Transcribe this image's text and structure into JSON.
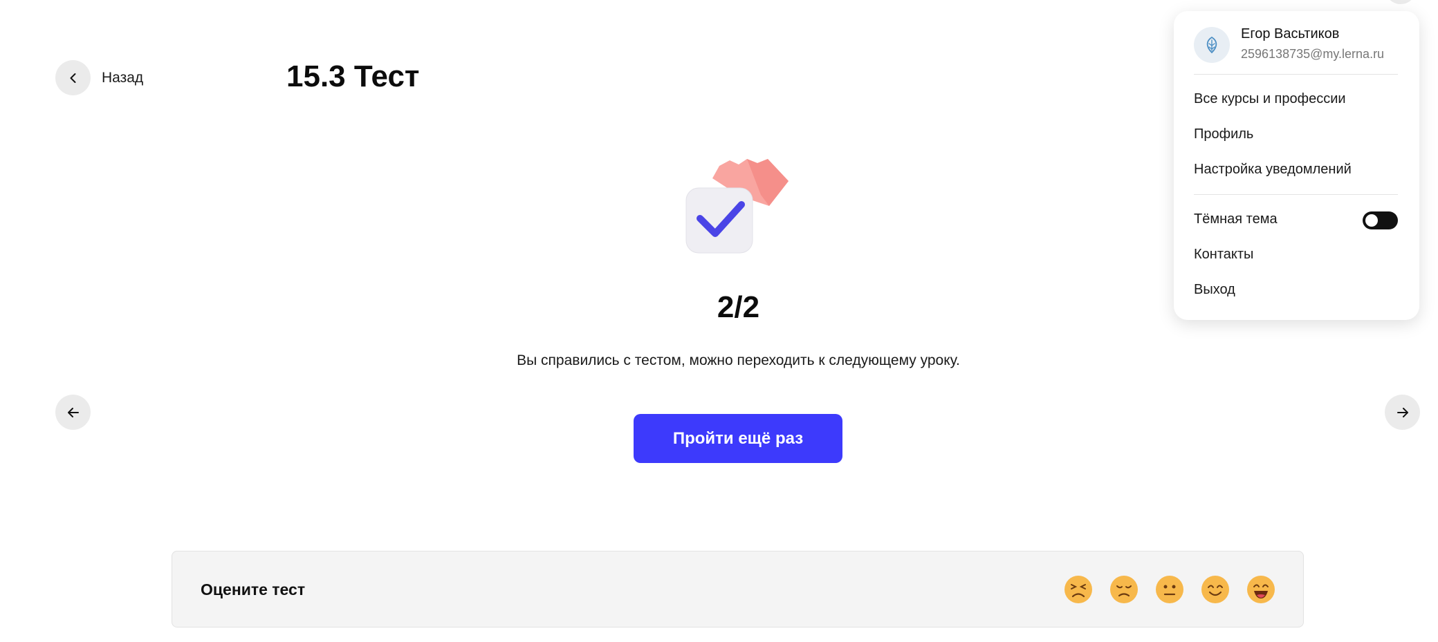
{
  "header": {
    "back_label": "Назад",
    "title": "15.3 Тест"
  },
  "result": {
    "score": "2/2",
    "message": "Вы справились с тестом, можно переходить к следующему уроку.",
    "retry_label": "Пройти ещё раз"
  },
  "rating": {
    "label": "Оцените тест",
    "options": [
      "angry-face-icon",
      "sad-face-icon",
      "neutral-face-icon",
      "smiling-face-icon",
      "grinning-face-icon"
    ]
  },
  "user_menu": {
    "name": "Егор Васьтиков",
    "email": "2596138735@my.lerna.ru",
    "items": [
      "Все курсы и профессии",
      "Профиль",
      "Настройка уведомлений"
    ],
    "dark_theme_label": "Тёмная тема",
    "dark_theme_enabled": false,
    "contacts_label": "Контакты",
    "logout_label": "Выход"
  },
  "colors": {
    "accent": "#3d3afc",
    "emoji": "#f7b84b"
  }
}
